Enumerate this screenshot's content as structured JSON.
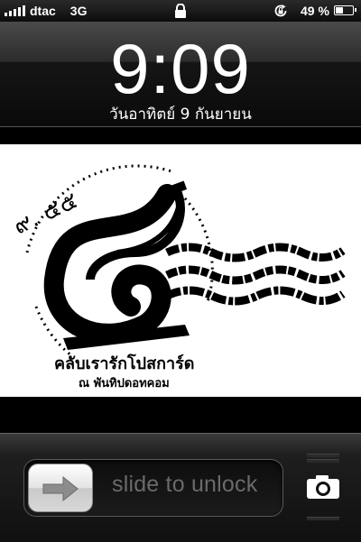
{
  "status_bar": {
    "carrier": "dtac",
    "network": "3G",
    "battery_percent": "49 %",
    "battery_level": 0.49,
    "icons": [
      "signal-icon",
      "lock-icon",
      "rotation-lock-icon",
      "battery-icon"
    ]
  },
  "clock": {
    "time": "9:09",
    "date": "วันอาทิตย์ 9 กันยายน"
  },
  "wallpaper": {
    "number_text": "๙. ๕๕",
    "title": "คลับเรารักโปสการ์ด",
    "subtitle": "ณ  พันทิปดอทคอม",
    "icons": [
      "assistive-touch-icon"
    ]
  },
  "unlock": {
    "slide_text": "slide to unlock",
    "icons": [
      "arrow-right-icon",
      "camera-icon"
    ]
  },
  "colors": {
    "background": "#000000",
    "slide_text": "#6a6a6a",
    "wallpaper_bg": "#ffffff"
  }
}
